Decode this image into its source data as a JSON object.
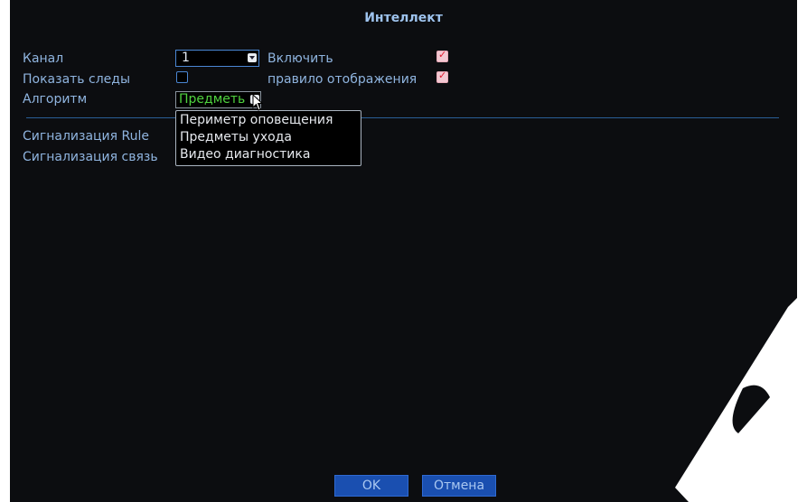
{
  "window": {
    "title": "Интеллект"
  },
  "fields": {
    "channel_label": "Канал",
    "channel_value": "1",
    "enable_label": "Включить",
    "show_traces_label": "Показать следы",
    "display_rule_label": "правило отображения",
    "algorithm_label": "Алгоритм",
    "algorithm_value": "Предметь",
    "alarm_rule_label": "Сигнализация Rule",
    "alarm_link_label": "Сигнализация связь"
  },
  "checkboxes": {
    "enable": true,
    "show_traces": false,
    "display_rule": true
  },
  "algorithm_options": [
    "Периметр оповещения",
    "Предметы ухода",
    "Видео диагностика"
  ],
  "buttons": {
    "ok": "OK",
    "cancel": "Отмена"
  },
  "colors": {
    "label": "#8fb4df",
    "selected_option": "#4fd23f",
    "button": "#1a4fb0"
  },
  "icons": [
    "chevron-down-icon",
    "mouse-cursor-icon",
    "checkbox-icon"
  ]
}
